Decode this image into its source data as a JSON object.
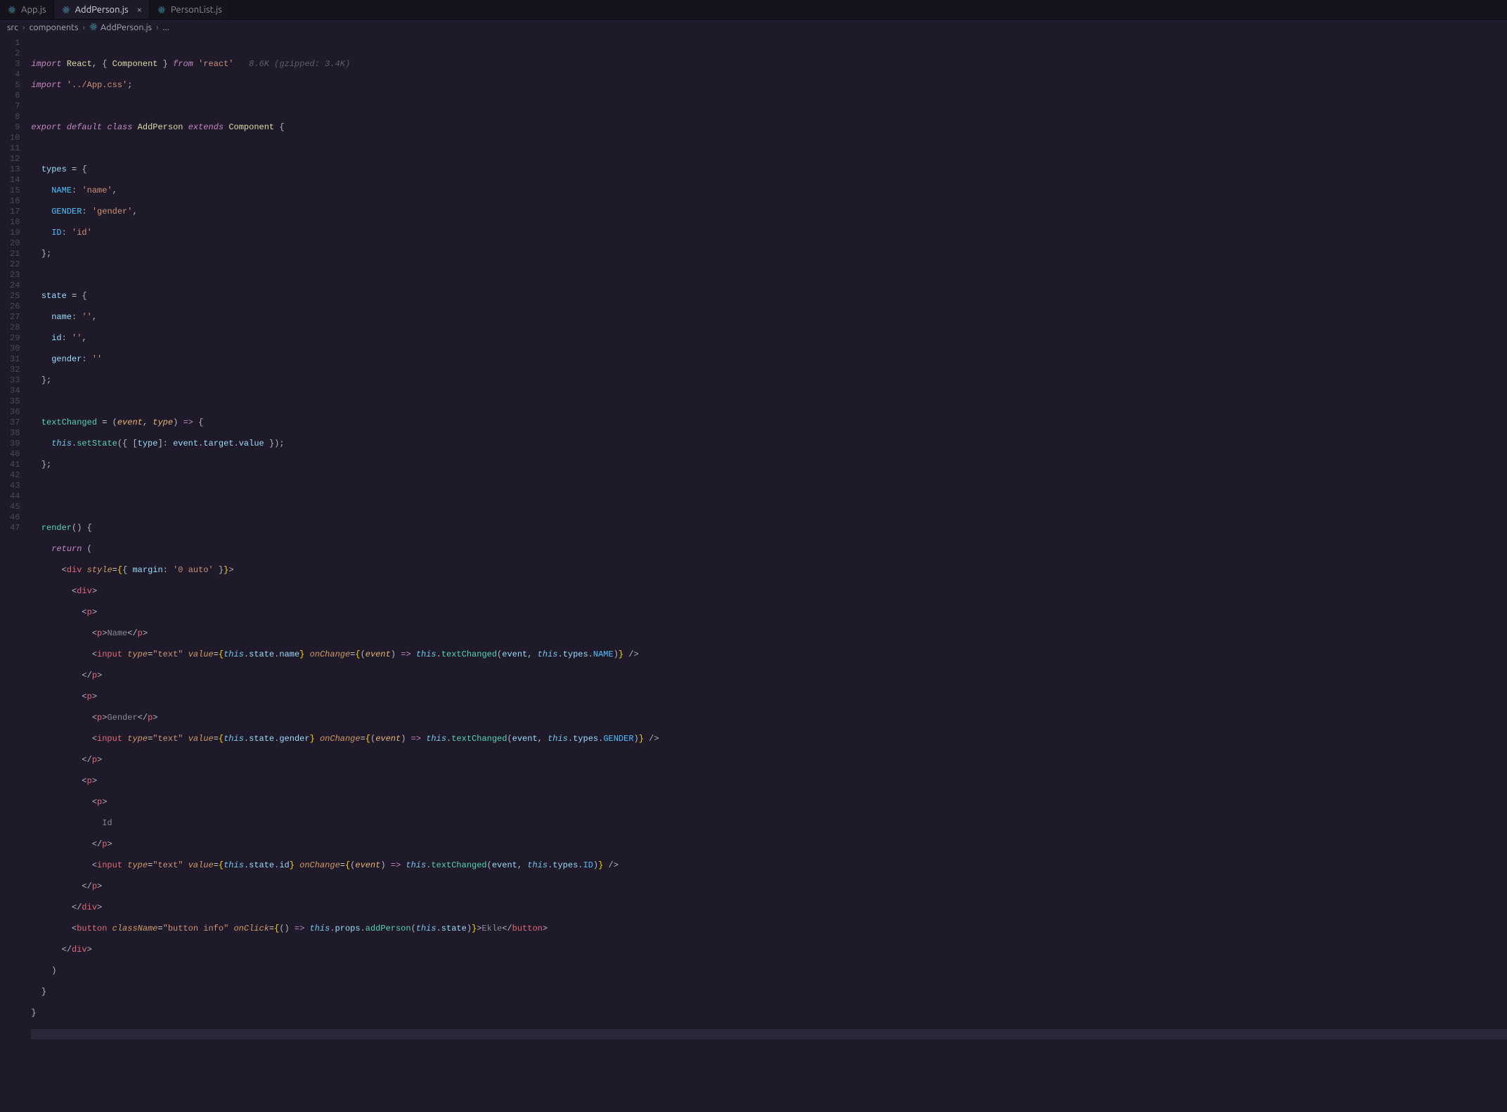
{
  "tabs": [
    {
      "label": "App.js",
      "active": false
    },
    {
      "label": "AddPerson.js",
      "active": true
    },
    {
      "label": "PersonList.js",
      "active": false
    }
  ],
  "breadcrumb": {
    "parts": [
      "src",
      "components",
      "AddPerson.js",
      "..."
    ],
    "sep": "›"
  },
  "size_hint": "8.6K (gzipped: 3.4K)",
  "line_count": 47,
  "cursor_line": 47,
  "strings": {
    "react": "'react'",
    "appcss": "'../App.css'",
    "name": "'name'",
    "gender": "'gender'",
    "id": "'id'",
    "empty": "''",
    "margin0auto": "'0 auto'",
    "text": "\"text\"",
    "buttoninfo": "\"button info\"",
    "labelName": "Name",
    "labelGender": "Gender",
    "labelId": "Id",
    "ekle": "Ekle"
  },
  "identifiers": {
    "React": "React",
    "Component": "Component",
    "AddPerson": "AddPerson",
    "types": "types",
    "NAME": "NAME",
    "GENDER": "GENDER",
    "ID": "ID",
    "state": "state",
    "name": "name",
    "id": "id",
    "gender": "gender",
    "textChanged": "textChanged",
    "event": "event",
    "type": "type",
    "setState": "setState",
    "target": "target",
    "value": "value",
    "render": "render",
    "style": "style",
    "margin": "margin",
    "className": "className",
    "onClick": "onClick",
    "onChange": "onChange",
    "props": "props",
    "addPerson": "addPerson"
  },
  "kw": {
    "import": "import",
    "from": "from",
    "export": "export",
    "default": "default",
    "class": "class",
    "extends": "extends",
    "this": "this",
    "return": "return"
  },
  "tags": {
    "div": "div",
    "p": "p",
    "input": "input",
    "button": "button"
  }
}
